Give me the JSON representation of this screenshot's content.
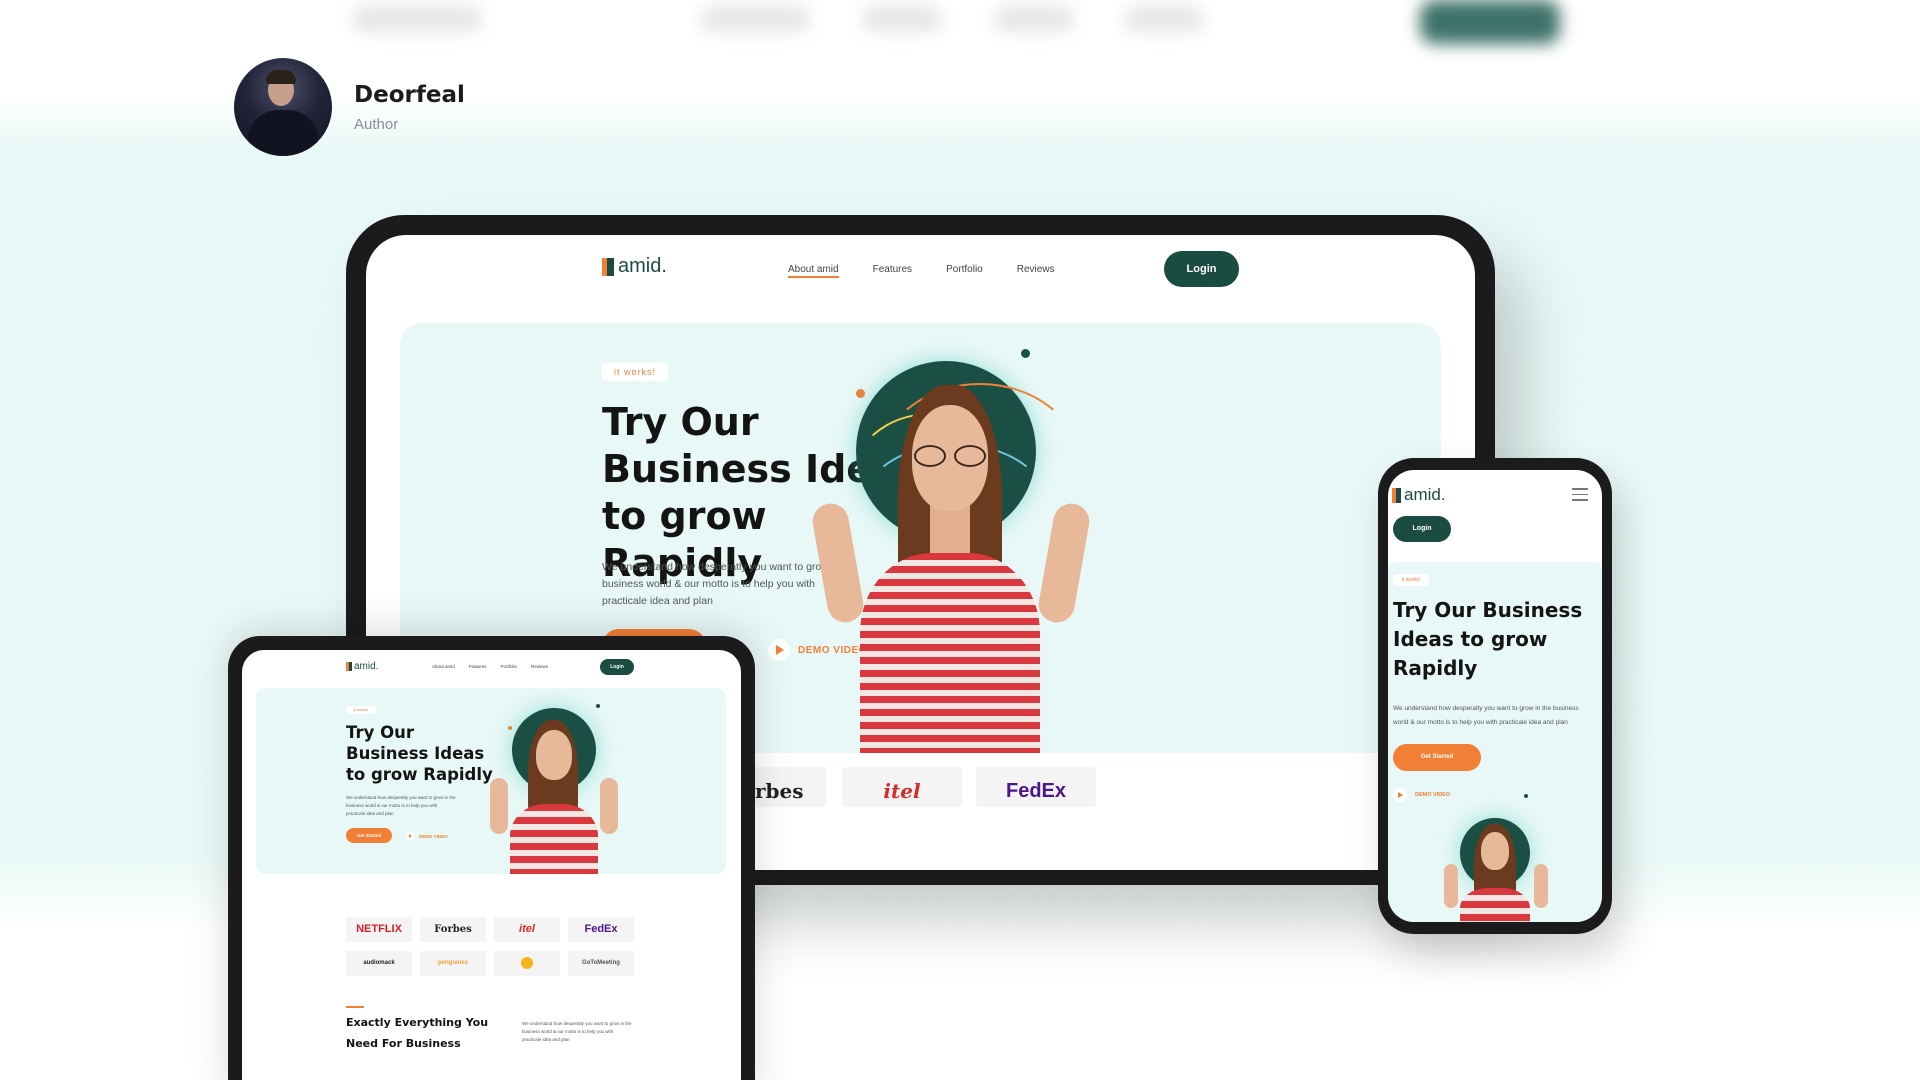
{
  "author": {
    "name": "Deorfeal",
    "role": "Author"
  },
  "site": {
    "brand": "amid.",
    "nav": [
      "About amid",
      "Features",
      "Portfolio",
      "Reviews"
    ],
    "login": "Login",
    "badge": "it works!",
    "headline": "Try Our Business Ideas to grow Rapidly",
    "headline_lines": [
      "Try Our",
      "Business Ideas",
      "to grow Rapidly"
    ],
    "description": "We understand how desperatly you want to grow in the business world & our motto is to help you with practicale idea and plan",
    "cta": "Get Started",
    "demo": "DEMO VIDEO",
    "section_title": "Exactly Everything You Need For Business",
    "section_text": "We understand how desperatly you want to grow in the business world & our motto is to help you with practicale idea and plan"
  },
  "logos": [
    "NETFLIX",
    "Forbes",
    "itel",
    "FedEx",
    "audiomack",
    "penguines",
    "",
    "GoToMeeting"
  ],
  "colors": {
    "accent": "#f27f36",
    "brand": "#1a4c42",
    "hero_bg": "#e8f8f6",
    "device": "#1b1b1d"
  }
}
